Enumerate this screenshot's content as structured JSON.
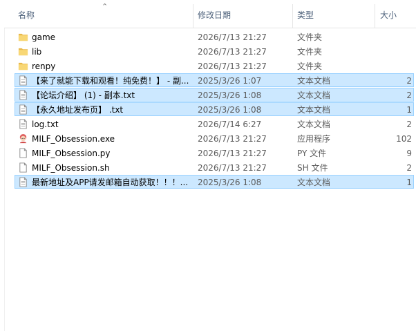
{
  "columns": {
    "name": "名称",
    "date": "修改日期",
    "type": "类型",
    "size": "大小"
  },
  "files": [
    {
      "name": "game",
      "date": "2026/7/13 21:27",
      "type": "文件夹",
      "size": "",
      "icon": "folder-icon",
      "selected": false
    },
    {
      "name": "lib",
      "date": "2026/7/13 21:27",
      "type": "文件夹",
      "size": "",
      "icon": "folder-icon",
      "selected": false
    },
    {
      "name": "renpy",
      "date": "2026/7/13 21:27",
      "type": "文件夹",
      "size": "",
      "icon": "folder-icon",
      "selected": false
    },
    {
      "name": "【来了就能下载和观看！纯免费！】 - 副...",
      "date": "2025/3/26 1:07",
      "type": "文本文档",
      "size": "2",
      "icon": "text-file-icon",
      "selected": true
    },
    {
      "name": "【论坛介绍】 (1) - 副本.txt",
      "date": "2025/3/26 1:08",
      "type": "文本文档",
      "size": "2",
      "icon": "text-file-icon",
      "selected": true
    },
    {
      "name": "【永久地址发布页】 .txt",
      "date": "2025/3/26 1:08",
      "type": "文本文档",
      "size": "1",
      "icon": "text-file-icon",
      "selected": true
    },
    {
      "name": "log.txt",
      "date": "2026/7/14 6:27",
      "type": "文本文档",
      "size": "2",
      "icon": "text-file-icon",
      "selected": false
    },
    {
      "name": "MILF_Obsession.exe",
      "date": "2026/7/13 21:27",
      "type": "应用程序",
      "size": "102",
      "icon": "app-exe-icon",
      "selected": false
    },
    {
      "name": "MILF_Obsession.py",
      "date": "2026/7/13 21:27",
      "type": "PY 文件",
      "size": "9",
      "icon": "blank-file-icon",
      "selected": false
    },
    {
      "name": "MILF_Obsession.sh",
      "date": "2026/7/13 21:27",
      "type": "SH 文件",
      "size": "2",
      "icon": "blank-file-icon",
      "selected": false
    },
    {
      "name": "最新地址及APP请发邮箱自动获取！！！...",
      "date": "2025/3/26 1:08",
      "type": "文本文档",
      "size": "1",
      "icon": "text-file-icon",
      "selected": true
    }
  ],
  "colors": {
    "selection_bg": "#cce8ff",
    "selection_border": "#99d1ff",
    "folder": "#f8d775",
    "header_text": "#4c607a"
  }
}
